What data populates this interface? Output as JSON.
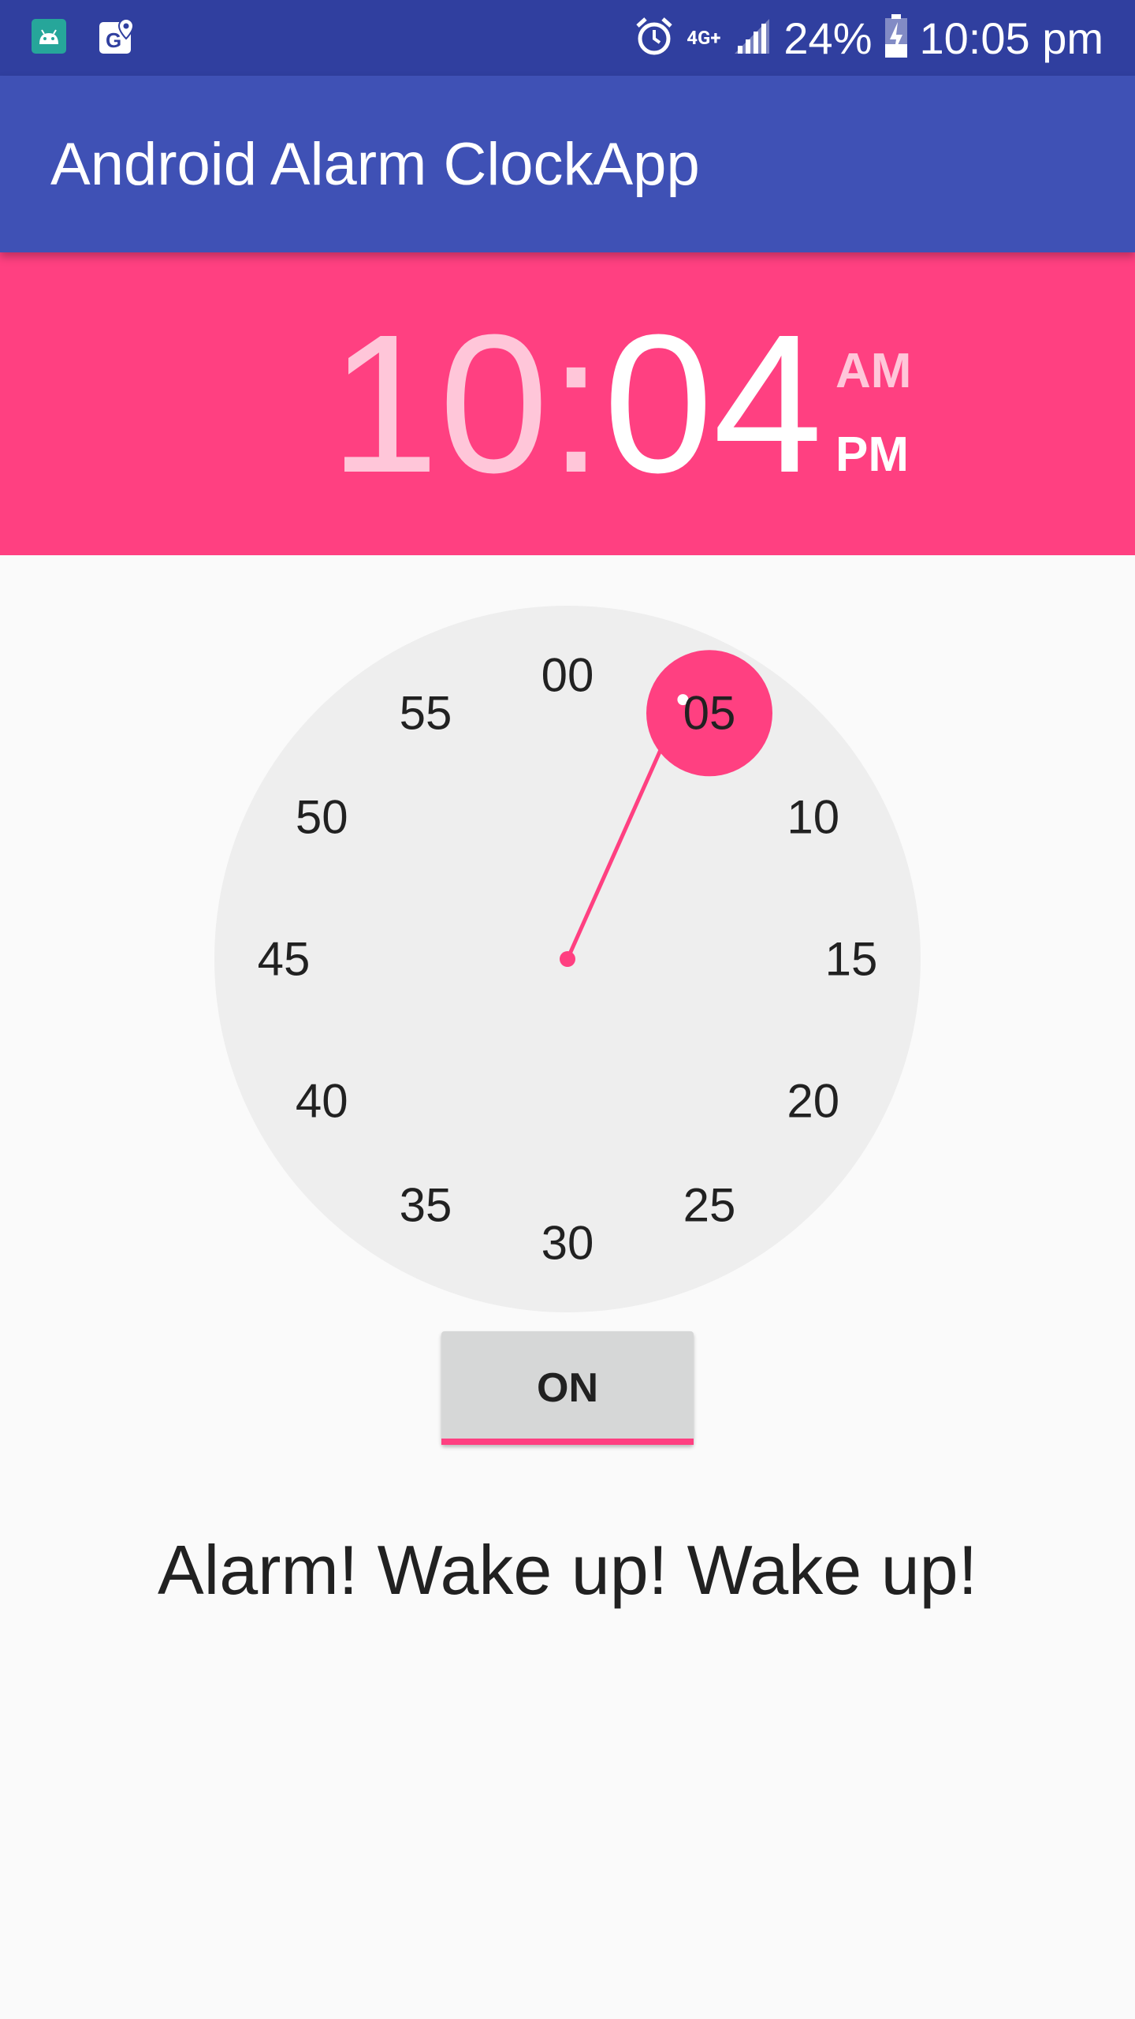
{
  "status_bar": {
    "network_label": "4G+",
    "battery": "24%",
    "time": "10:05 pm"
  },
  "app_bar": {
    "title": "Android Alarm ClockApp"
  },
  "time_picker": {
    "hour": "10",
    "separator": ":",
    "minute": "04",
    "am_label": "AM",
    "pm_label": "PM",
    "selected_period": "PM",
    "dial_numbers": [
      "00",
      "05",
      "10",
      "15",
      "20",
      "25",
      "30",
      "35",
      "40",
      "45",
      "50",
      "55"
    ],
    "selected_dial_value": "05",
    "hand_minute_value": 4
  },
  "toggle_button": {
    "label": "ON"
  },
  "message": "Alarm! Wake up! Wake up!",
  "colors": {
    "status_bar": "#303f9f",
    "app_bar": "#3f51b5",
    "accent": "#ff4081",
    "dial_face": "#eeeeee"
  },
  "icons": [
    "android-notification-icon",
    "maps-notification-icon",
    "alarm-icon",
    "signal-icon",
    "battery-charging-icon"
  ]
}
